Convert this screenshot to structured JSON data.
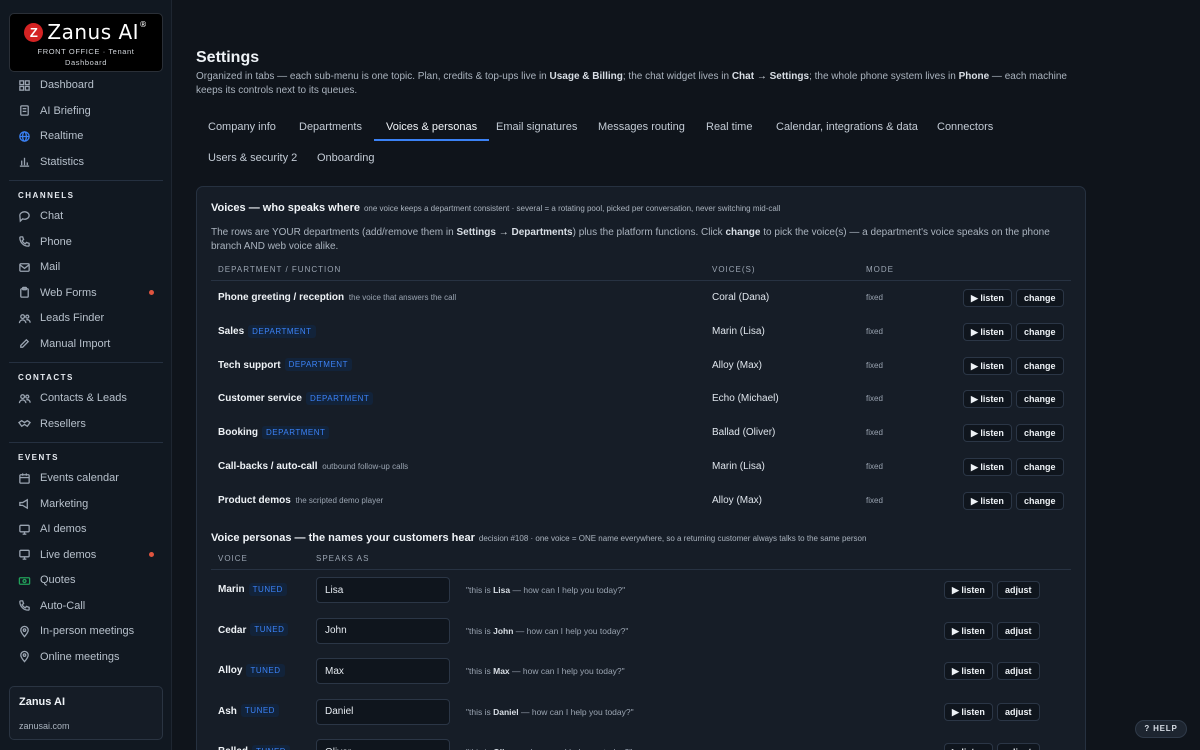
{
  "brand": {
    "logo_text": "Zanus AI",
    "logo_mark": "Z",
    "logo_reg": "®",
    "subtitle_line1": "FRONT OFFICE · Tenant",
    "subtitle_line2": "Dashboard"
  },
  "sidebar": {
    "top_items": [
      {
        "label": "Dashboard",
        "icon": "grid-icon"
      },
      {
        "label": "AI Briefing",
        "icon": "document-icon"
      },
      {
        "label": "Realtime",
        "icon": "globe-icon"
      },
      {
        "label": "Statistics",
        "icon": "bar-chart-icon"
      }
    ],
    "sections": [
      {
        "title": "CHANNELS",
        "items": [
          {
            "label": "Chat",
            "icon": "chat-bubble-icon"
          },
          {
            "label": "Phone",
            "icon": "phone-icon"
          },
          {
            "label": "Mail",
            "icon": "mail-icon"
          },
          {
            "label": "Web Forms",
            "icon": "clipboard-icon",
            "dot": true
          },
          {
            "label": "Leads Finder",
            "icon": "users-icon"
          },
          {
            "label": "Manual Import",
            "icon": "edit-icon"
          }
        ]
      },
      {
        "title": "CONTACTS",
        "items": [
          {
            "label": "Contacts & Leads",
            "icon": "users-icon"
          },
          {
            "label": "Resellers",
            "icon": "handshake-icon"
          }
        ]
      },
      {
        "title": "EVENTS",
        "items": [
          {
            "label": "Events calendar",
            "icon": "calendar-icon"
          },
          {
            "label": "Marketing",
            "icon": "megaphone-icon"
          },
          {
            "label": "AI demos",
            "icon": "monitor-icon"
          },
          {
            "label": "Live demos",
            "icon": "monitor-icon",
            "dot": true
          },
          {
            "label": "Quotes",
            "icon": "cash-icon"
          },
          {
            "label": "Auto-Call",
            "icon": "phone-icon"
          },
          {
            "label": "In-person meetings",
            "icon": "map-pin-icon"
          },
          {
            "label": "Online meetings",
            "icon": "map-pin-icon"
          }
        ]
      }
    ],
    "tenant": {
      "name": "Zanus AI",
      "domain": "zanusai.com"
    }
  },
  "page": {
    "title": "Settings",
    "desc_parts": {
      "p1": "Organized in tabs — each sub-menu is one topic. Plan, credits & top-ups live in ",
      "b1": "Usage & Billing",
      "p2": "; the chat widget lives in ",
      "b2": "Chat → Settings",
      "p3": "; the whole phone system lives in ",
      "b3": "Phone",
      "p4": " — each machine keeps its controls next to its queues."
    }
  },
  "tabs": [
    {
      "label": "Company info"
    },
    {
      "label": "Departments"
    },
    {
      "label": "Voices & personas",
      "active": true
    },
    {
      "label": "Email signatures"
    },
    {
      "label": "Messages routing"
    },
    {
      "label": "Real time"
    },
    {
      "label": "Calendar, integrations & data"
    },
    {
      "label": "Connectors"
    },
    {
      "label": "Users & security 2"
    },
    {
      "label": "Onboarding"
    }
  ],
  "voices": {
    "title": "Voices — who speaks where",
    "hint": "one voice keeps a department consistent · several = a rotating pool, picked per conversation, never switching mid-call",
    "desc": {
      "p1": "The rows are YOUR departments (add/remove them in ",
      "b1": "Settings → Departments",
      "p2": ") plus the platform functions. Click ",
      "b2": "change",
      "p3": " to pick the voice(s) — a department's voice speaks on the phone branch AND web voice alike."
    },
    "headers": {
      "fn": "DEPARTMENT / FUNCTION",
      "voice": "VOICE(S)",
      "mode": "MODE"
    },
    "listen_label": "▶ listen",
    "change_label": "change",
    "rows": [
      {
        "name": "Phone greeting / reception",
        "sub": "the voice that answers the call",
        "badge": "",
        "voice": "Coral (Dana)",
        "mode": "fixed"
      },
      {
        "name": "Sales",
        "sub": "",
        "badge": "DEPARTMENT",
        "voice": "Marin (Lisa)",
        "mode": "fixed"
      },
      {
        "name": "Tech support",
        "sub": "",
        "badge": "DEPARTMENT",
        "voice": "Alloy (Max)",
        "mode": "fixed"
      },
      {
        "name": "Customer service",
        "sub": "",
        "badge": "DEPARTMENT",
        "voice": "Echo (Michael)",
        "mode": "fixed"
      },
      {
        "name": "Booking",
        "sub": "",
        "badge": "DEPARTMENT",
        "voice": "Ballad (Oliver)",
        "mode": "fixed"
      },
      {
        "name": "Call-backs / auto-call",
        "sub": "outbound follow-up calls",
        "badge": "",
        "voice": "Marin (Lisa)",
        "mode": "fixed"
      },
      {
        "name": "Product demos",
        "sub": "the scripted demo player",
        "badge": "",
        "voice": "Alloy (Max)",
        "mode": "fixed"
      }
    ]
  },
  "personas": {
    "title": "Voice personas — the names your customers hear",
    "hint": "decision #108 · one voice = ONE name everywhere, so a returning customer always talks to the same person",
    "headers": {
      "voice": "VOICE",
      "speaks_as": "SPEAKS AS"
    },
    "listen_label": "▶ listen",
    "adjust_label": "adjust",
    "preview_pre": "\"this is ",
    "preview_post": " — how can I help you today?\"",
    "rows": [
      {
        "voice": "Marin",
        "badge": "TUNED",
        "name": "Lisa"
      },
      {
        "voice": "Cedar",
        "badge": "TUNED",
        "name": "John"
      },
      {
        "voice": "Alloy",
        "badge": "TUNED",
        "name": "Max"
      },
      {
        "voice": "Ash",
        "badge": "TUNED",
        "name": "Daniel"
      },
      {
        "voice": "Ballad",
        "badge": "TUNED",
        "name": "Oliver"
      }
    ]
  },
  "help_label": "? HELP"
}
